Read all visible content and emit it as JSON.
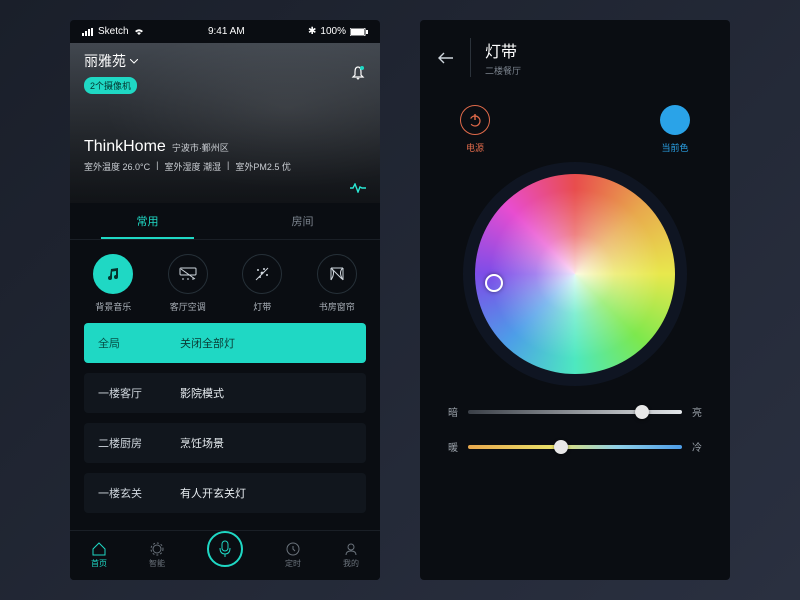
{
  "status": {
    "carrier": "Sketch",
    "time": "9:41 AM",
    "battery": "100%"
  },
  "hero": {
    "home_name": "丽雅苑",
    "camera_badge": "2个摄像机",
    "brand": "ThinkHome",
    "location": "宁波市·鄞州区",
    "temp_label": "室外温度",
    "temp_val": "26.0°C",
    "hum_label": "室外湿度",
    "hum_val": "潮湿",
    "pm_label": "室外PM2.5",
    "pm_val": "优"
  },
  "tabs": {
    "common": "常用",
    "rooms": "房间"
  },
  "quick": [
    {
      "label": "背景音乐"
    },
    {
      "label": "客厅空调"
    },
    {
      "label": "灯带"
    },
    {
      "label": "书房窗帘"
    }
  ],
  "scenes": [
    {
      "room": "全局",
      "mode": "关闭全部灯",
      "highlight": true
    },
    {
      "room": "一楼客厅",
      "mode": "影院模式"
    },
    {
      "room": "二楼厨房",
      "mode": "烹饪场景"
    },
    {
      "room": "一楼玄关",
      "mode": "有人开玄关灯"
    }
  ],
  "nav": {
    "home": "首页",
    "smart": "智能",
    "timer": "定时",
    "me": "我的"
  },
  "detail": {
    "title": "灯带",
    "subtitle": "二楼餐厅",
    "power": "电源",
    "color": "当前色",
    "current_color": "#2aa3e8",
    "dim_min": "暗",
    "dim_max": "亮",
    "warm": "暖",
    "cool": "冷",
    "brightness_pct": 78,
    "temp_pct": 40
  }
}
